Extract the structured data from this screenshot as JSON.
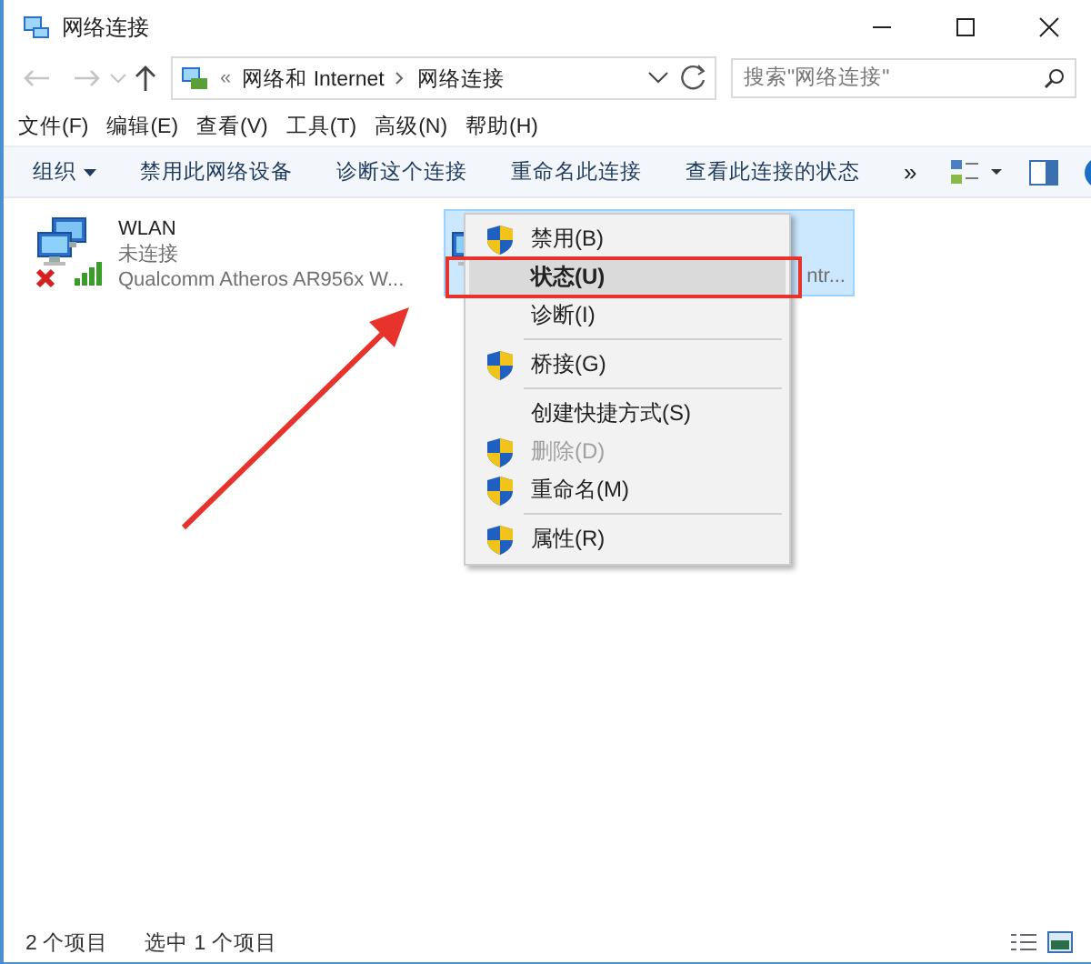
{
  "window": {
    "title": "网络连接"
  },
  "address": {
    "overflow": "«",
    "path": [
      "网络和 Internet",
      "网络连接"
    ]
  },
  "search": {
    "placeholder": "搜索\"网络连接\""
  },
  "menu_bar": [
    "文件(F)",
    "编辑(E)",
    "查看(V)",
    "工具(T)",
    "高级(N)",
    "帮助(H)"
  ],
  "command_bar": {
    "items": [
      {
        "label": "组织",
        "dropdown": true
      },
      {
        "label": "禁用此网络设备",
        "dropdown": false
      },
      {
        "label": "诊断这个连接",
        "dropdown": false
      },
      {
        "label": "重命名此连接",
        "dropdown": false
      },
      {
        "label": "查看此连接的状态",
        "dropdown": false
      }
    ],
    "more": "»"
  },
  "connections": [
    {
      "name": "WLAN",
      "status": "未连接",
      "device": "Qualcomm Atheros AR956x W...",
      "selected": false,
      "disconnected": true
    },
    {
      "device": "ntr...",
      "selected": true
    }
  ],
  "context_menu": [
    {
      "kind": "item",
      "label": "禁用(B)",
      "shield": true,
      "disabled": false,
      "default": false,
      "selected": false
    },
    {
      "kind": "item",
      "label": "状态(U)",
      "shield": false,
      "disabled": false,
      "default": true,
      "selected": true
    },
    {
      "kind": "item",
      "label": "诊断(I)",
      "shield": false,
      "disabled": false,
      "default": false,
      "selected": false
    },
    {
      "kind": "separator"
    },
    {
      "kind": "item",
      "label": "桥接(G)",
      "shield": true,
      "disabled": false,
      "default": false,
      "selected": false
    },
    {
      "kind": "separator"
    },
    {
      "kind": "item",
      "label": "创建快捷方式(S)",
      "shield": false,
      "disabled": false,
      "default": false,
      "selected": false
    },
    {
      "kind": "item",
      "label": "删除(D)",
      "shield": true,
      "disabled": true,
      "default": false,
      "selected": false
    },
    {
      "kind": "item",
      "label": "重命名(M)",
      "shield": true,
      "disabled": false,
      "default": false,
      "selected": false
    },
    {
      "kind": "separator"
    },
    {
      "kind": "item",
      "label": "属性(R)",
      "shield": true,
      "disabled": false,
      "default": false,
      "selected": false
    }
  ],
  "status_bar": {
    "count": "2 个项目",
    "selection": "选中 1 个项目"
  }
}
